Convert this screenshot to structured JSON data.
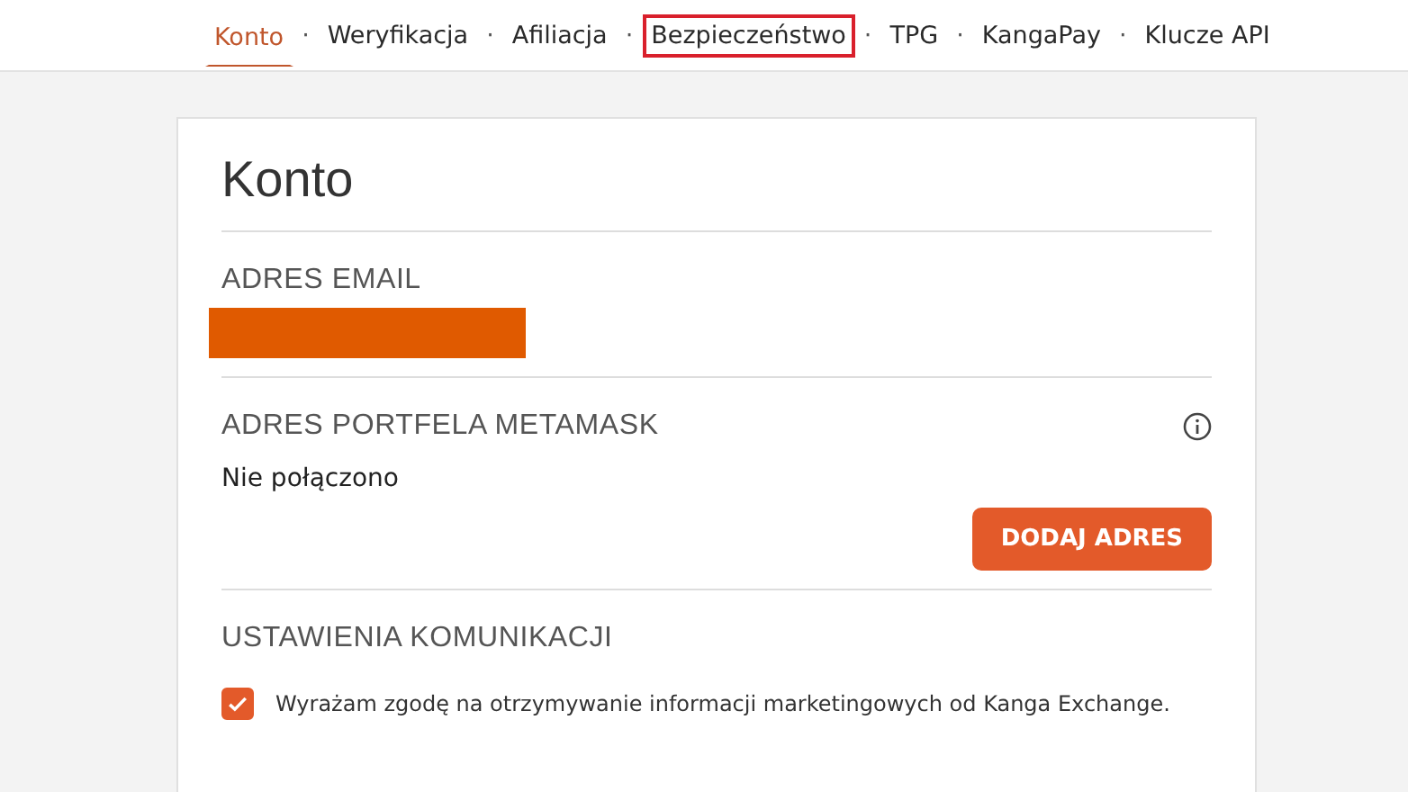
{
  "nav": {
    "separator": "·",
    "tabs": [
      {
        "label": "Konto",
        "selected": true,
        "highlighted": false
      },
      {
        "label": "Weryfikacja",
        "selected": false,
        "highlighted": false
      },
      {
        "label": "Afiliacja",
        "selected": false,
        "highlighted": false
      },
      {
        "label": "Bezpieczeństwo",
        "selected": false,
        "highlighted": true
      },
      {
        "label": "TPG",
        "selected": false,
        "highlighted": false
      },
      {
        "label": "KangaPay",
        "selected": false,
        "highlighted": false
      },
      {
        "label": "Klucze API",
        "selected": false,
        "highlighted": false
      }
    ]
  },
  "card": {
    "title": "Konto",
    "email": {
      "heading": "ADRES EMAIL",
      "redacted": true
    },
    "metamask": {
      "heading": "ADRES PORTFELA METAMASK",
      "status": "Nie połączono",
      "button": "DODAJ ADRES"
    },
    "communication": {
      "heading": "USTAWIENIA KOMUNIKACJI",
      "consent": {
        "label": "Wyrażam zgodę na otrzymywanie informacji marketingowych od Kanga Exchange.",
        "checked": true
      }
    }
  }
}
